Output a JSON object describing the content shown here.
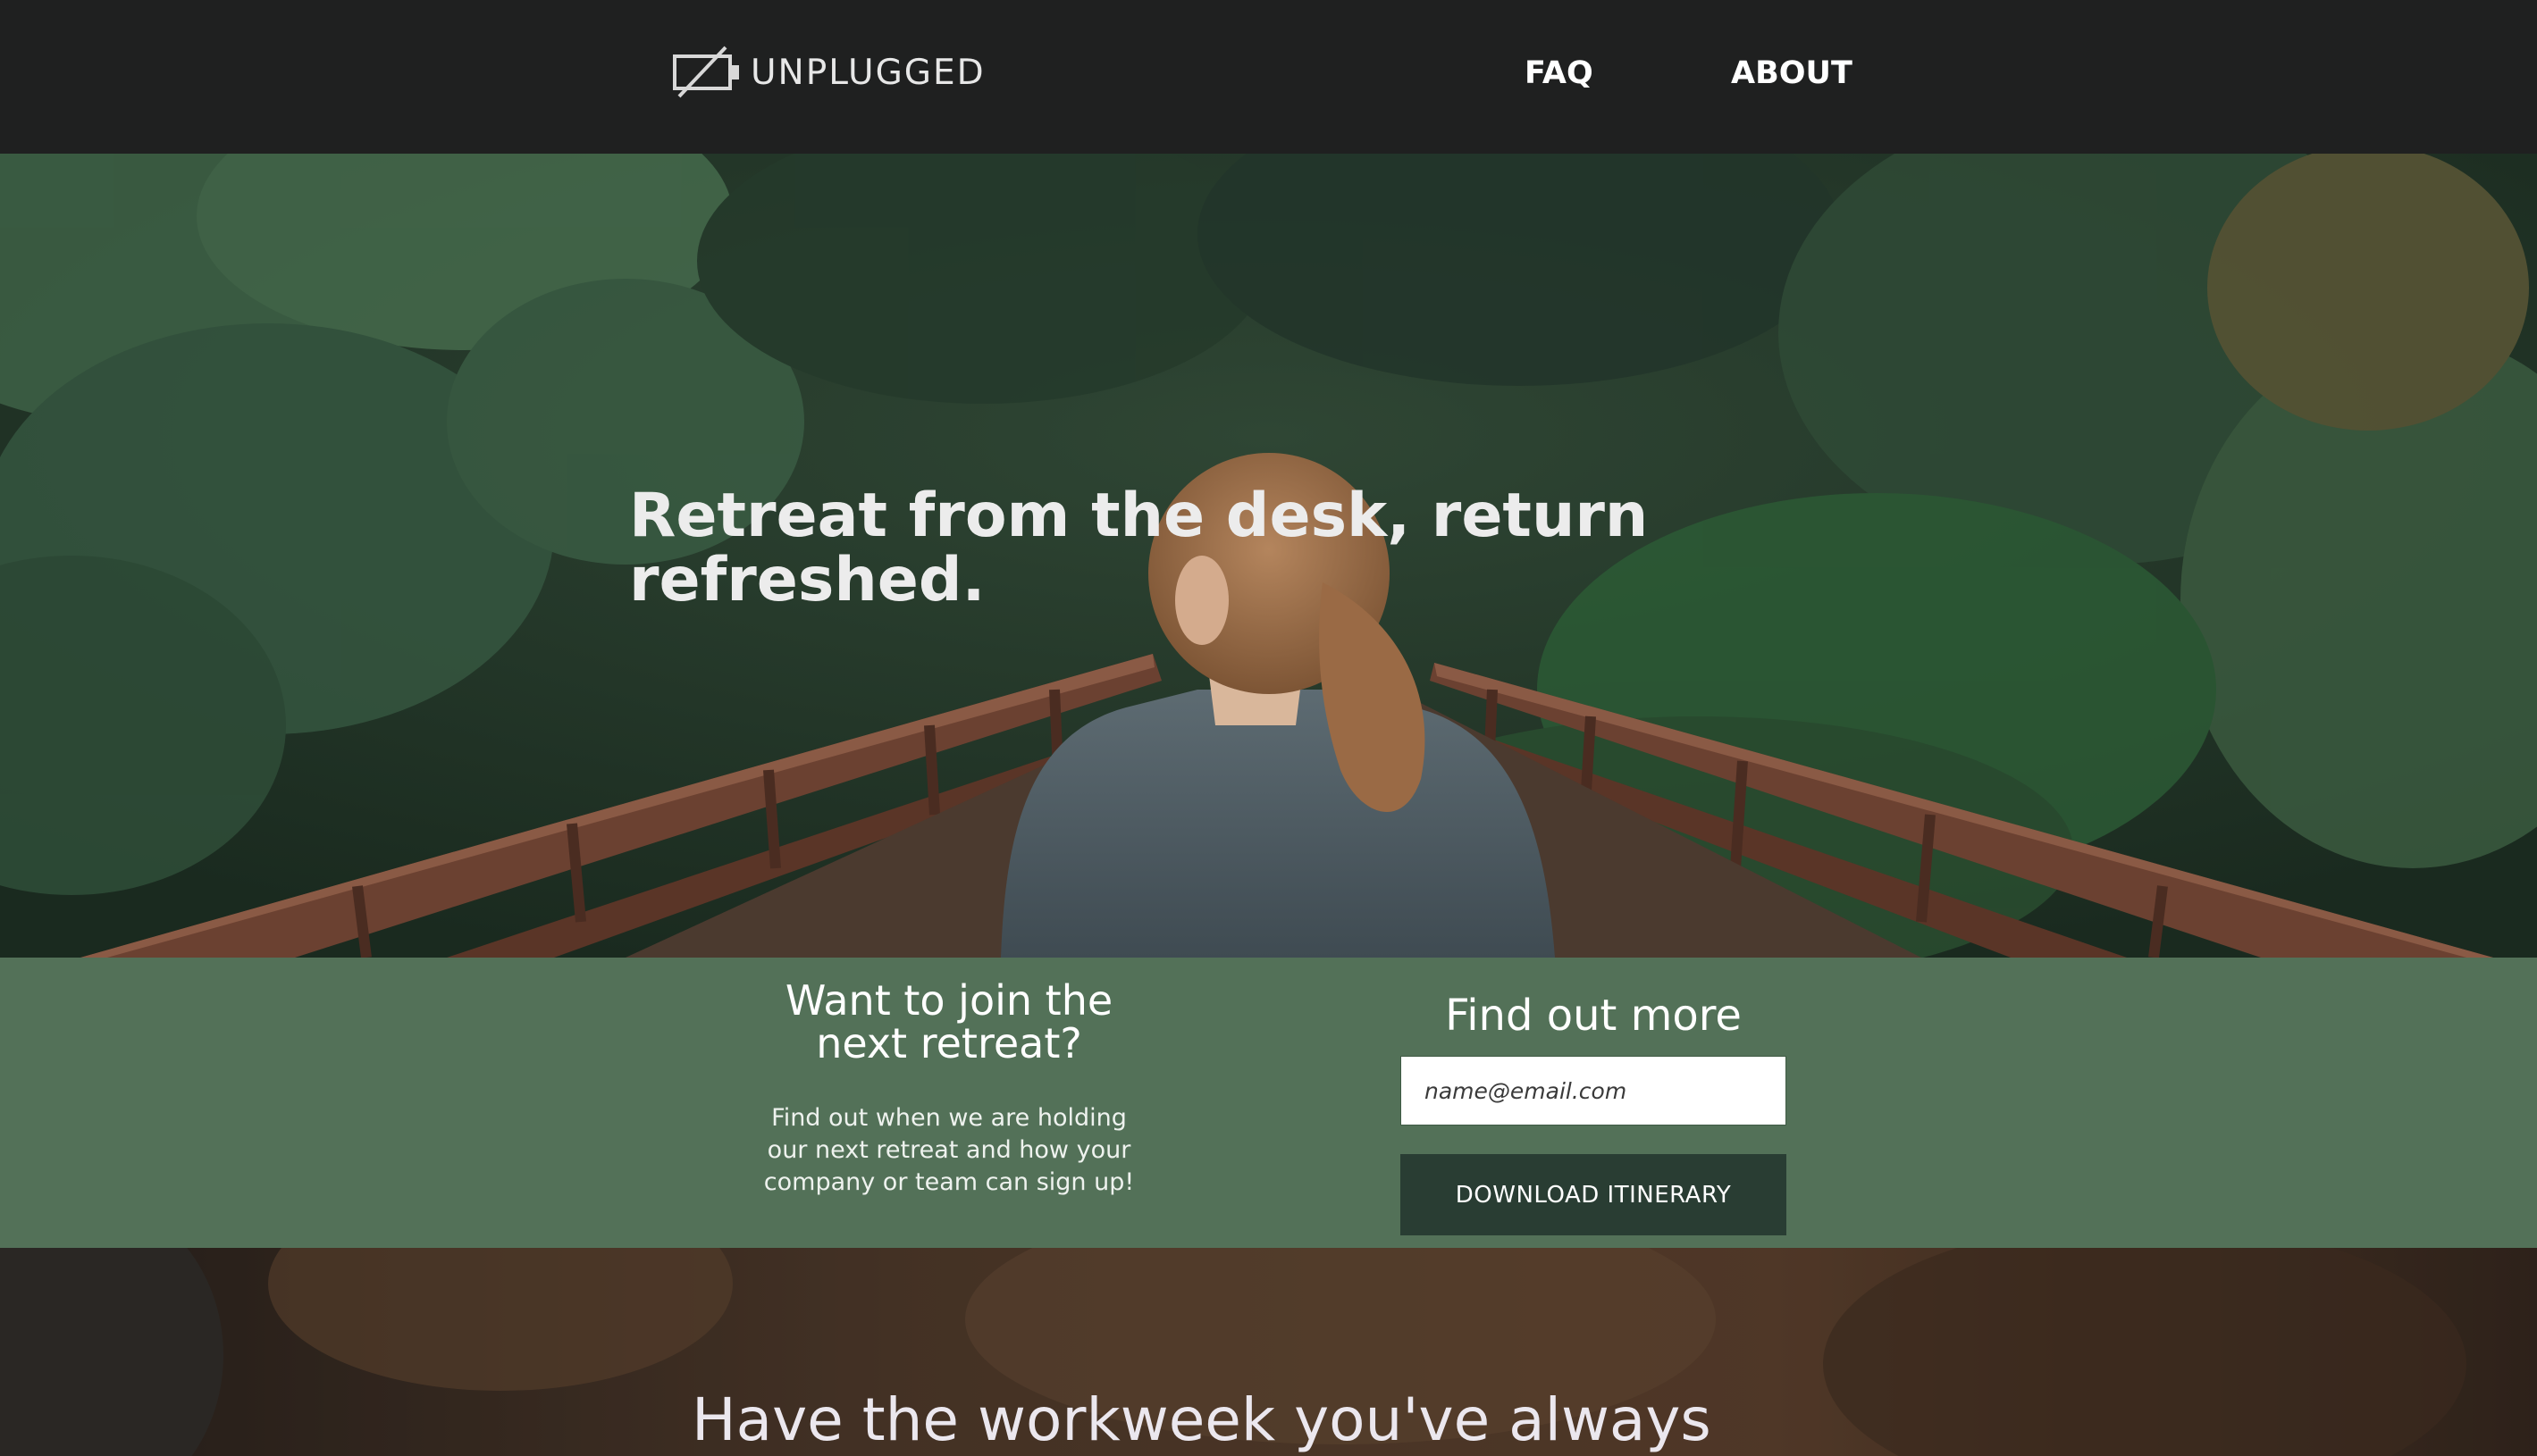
{
  "header": {
    "logo_text": "UNPLUGGED",
    "logo_icon": "crossed-battery-icon",
    "nav": [
      {
        "label": "FAQ"
      },
      {
        "label": "ABOUT"
      }
    ]
  },
  "hero": {
    "title": "Retreat from the desk, return refreshed."
  },
  "signup": {
    "heading": "Want to join the next retreat?",
    "text": "Find out when we are holding our next retreat and how your company or team can sign up!",
    "form_heading": "Find out more",
    "email_placeholder": "name@email.com",
    "button_label": "DOWNLOAD ITINERARY"
  },
  "bottom": {
    "heading": "Have the workweek you've always"
  },
  "colors": {
    "header_bg": "#1f2020",
    "signup_bg": "#537158",
    "button_bg": "#293d33",
    "text_light": "#ffffff"
  }
}
